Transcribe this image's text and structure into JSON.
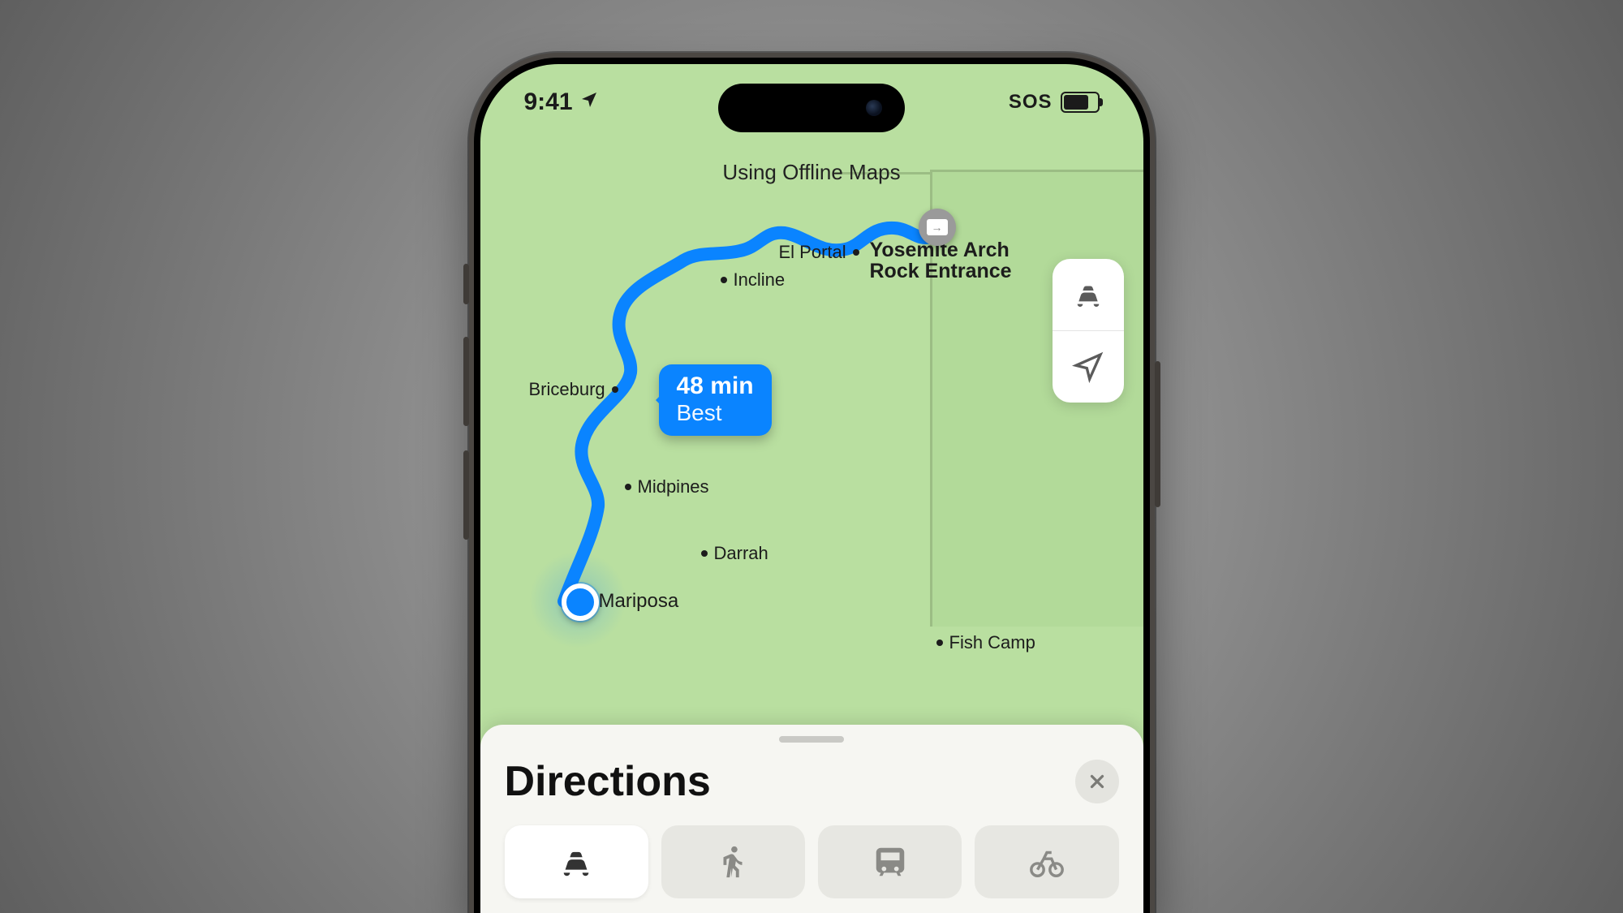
{
  "status": {
    "time": "9:41",
    "net": "SOS"
  },
  "banner": "Using Offline Maps",
  "callout": {
    "time": "48 min",
    "qual": "Best"
  },
  "places": {
    "el_portal": "El Portal",
    "incline": "Incline",
    "briceburg": "Briceburg",
    "midpines": "Midpines",
    "darrah": "Darrah",
    "mariposa": "Mariposa",
    "fish_camp": "Fish Camp",
    "dest_line1": "Yosemite Arch",
    "dest_line2": "Rock Entrance"
  },
  "sheet": {
    "title": "Directions"
  },
  "route": {
    "start": "Mariposa",
    "end": "Yosemite Arch Rock Entrance",
    "duration_min": 48
  }
}
